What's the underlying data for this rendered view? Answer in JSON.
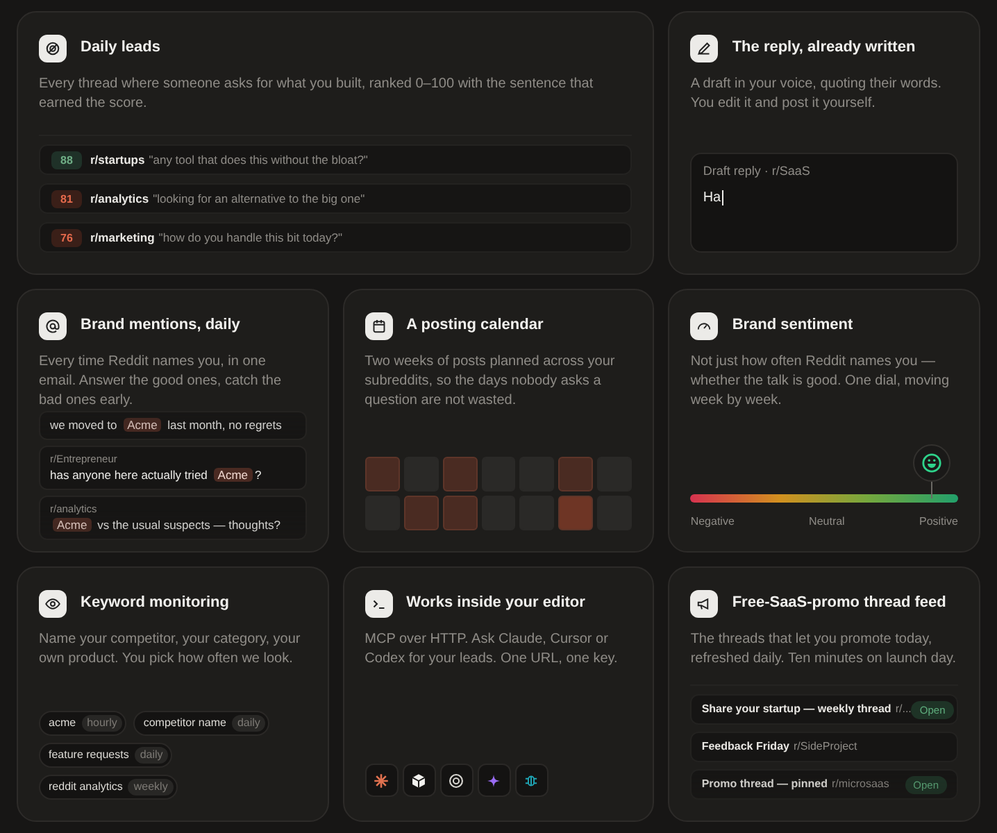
{
  "cards": [
    {
      "kind": "leads",
      "title": "Daily leads",
      "description": "Every thread where someone asks for what you built, ranked 0–100 with the sentence that earned the score.",
      "leads": [
        {
          "score": "88",
          "kind": "high",
          "subreddit": "r/startups",
          "quote": "\"any tool that does this without the bloat?\""
        },
        {
          "score": "81",
          "kind": "medium",
          "subreddit": "r/analytics",
          "quote": "\"looking for an alternative to the big one\""
        },
        {
          "score": "76",
          "kind": "medium",
          "subreddit": "r/marketing",
          "quote": "\"how do you handle this bit today?\""
        }
      ]
    },
    {
      "kind": "draft",
      "title": "The reply, already written",
      "description": "A draft in your voice, quoting their words. You edit it and post it yourself.",
      "draft": {
        "label": "Draft reply · r/SaaS",
        "value": "Ha"
      }
    },
    {
      "kind": "mentions",
      "title": "Brand mentions, daily",
      "description": "Every time Reddit names you, in one email. Answer the good ones, catch the bad ones early.",
      "mentions": [
        {
          "before": "we moved to ",
          "brand": "Acme",
          "after": " last month, no regrets"
        },
        {
          "subreddit": "r/Entrepreneur",
          "before": "has anyone here actually tried ",
          "brand": "Acme",
          "after": "?"
        },
        {
          "subreddit": "r/analytics",
          "brand": "Acme",
          "after": " vs the usual suspects — thoughts?"
        }
      ]
    },
    {
      "kind": "calendar",
      "title": "A posting calendar",
      "description": "Two weeks of posts planned across your subreddits, so the days nobody asks a question are not wasted.",
      "weeks": [
        [
          {
            "planned": true,
            "highlighted": false
          },
          {
            "planned": false,
            "highlighted": false
          },
          {
            "planned": true,
            "highlighted": false
          },
          {
            "planned": false,
            "highlighted": false
          },
          {
            "planned": false,
            "highlighted": false
          },
          {
            "planned": true,
            "highlighted": false
          },
          {
            "planned": false,
            "highlighted": false
          }
        ],
        [
          {
            "planned": false,
            "highlighted": false
          },
          {
            "planned": true,
            "highlighted": false
          },
          {
            "planned": true,
            "highlighted": false
          },
          {
            "planned": false,
            "highlighted": false
          },
          {
            "planned": false,
            "highlighted": false
          },
          {
            "planned": true,
            "highlighted": true
          },
          {
            "planned": false,
            "highlighted": false
          }
        ]
      ]
    },
    {
      "kind": "sentiment",
      "title": "Brand sentiment",
      "description": "Not just how often Reddit names you — whether the talk is good. One dial, moving week by week.",
      "level": 0.9,
      "scale": [
        "Negative",
        "Neutral",
        "Positive"
      ]
    },
    {
      "kind": "keywords",
      "title": "Keyword monitoring",
      "description": "Name your competitor, your category, your own product. You pick how often we look.",
      "keywords": [
        {
          "name": "acme",
          "frequency": "hourly"
        },
        {
          "name": "competitor name",
          "frequency": "daily"
        },
        {
          "name": "feature requests",
          "frequency": "daily"
        },
        {
          "name": "reddit analytics",
          "frequency": "weekly"
        }
      ]
    },
    {
      "kind": "editor",
      "title": "Works inside your editor",
      "description": "MCP over HTTP. Ask Claude, Cursor or Codex for your leads. One URL, one key."
    },
    {
      "kind": "promo",
      "title": "Free-SaaS-promo thread feed",
      "description": "The threads that let you promote today, refreshed daily. Ten minutes on launch day.",
      "threads": [
        {
          "title": "Share your startup — weekly thread",
          "subreddit": "r/...",
          "status": "Open"
        },
        {
          "title": "Feedback Friday",
          "subreddit": "r/SideProject"
        },
        {
          "title": "Promo thread — pinned",
          "subreddit": "r/microsaas",
          "status": "Open"
        }
      ]
    }
  ]
}
